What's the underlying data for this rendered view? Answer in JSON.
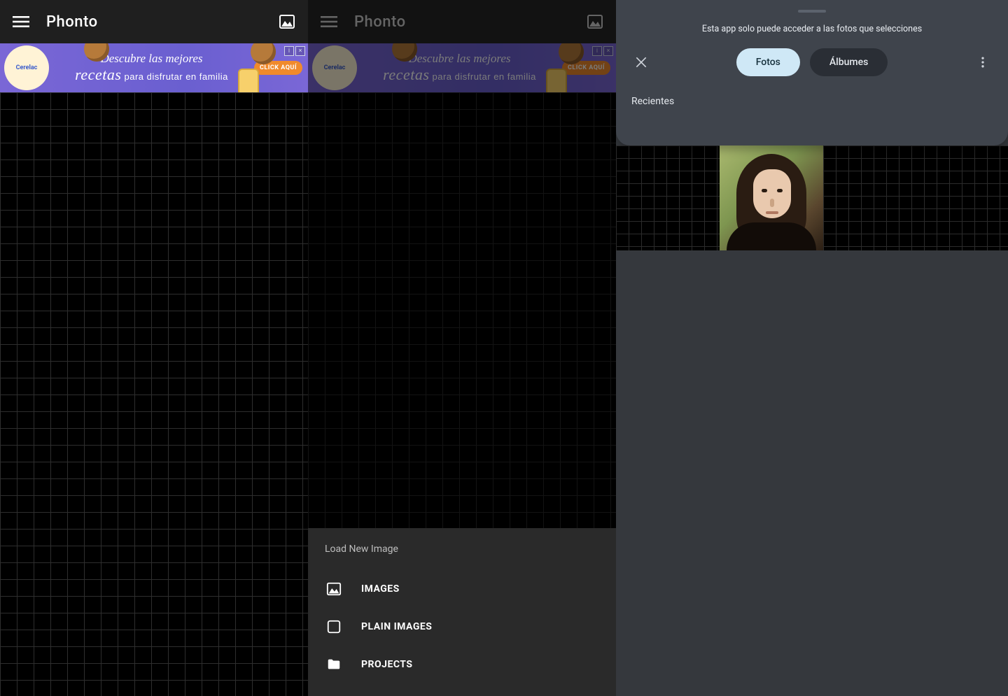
{
  "app_title": "Phonto",
  "ad": {
    "brand": "Cerelac",
    "line1": "Descubre las mejores",
    "line2_strong": "recetas",
    "line2_rest": " para disfrutar en familia",
    "cta": "CLICK AQUÍ",
    "info_glyph": "i",
    "close_glyph": "×"
  },
  "sheet": {
    "title": "Load New Image",
    "items": [
      {
        "label": "IMAGES"
      },
      {
        "label": "PLAIN IMAGES"
      },
      {
        "label": "PROJECTS"
      }
    ]
  },
  "picker": {
    "access_msg": "Esta app solo puede acceder a las fotos que selecciones",
    "tab_photos": "Fotos",
    "tab_albums": "Álbumes",
    "recents": "Recientes"
  },
  "colors": {
    "accent": "#cfe8f6",
    "sheet_bg": "#2a2a2a",
    "picker_bg": "#3f444c"
  }
}
